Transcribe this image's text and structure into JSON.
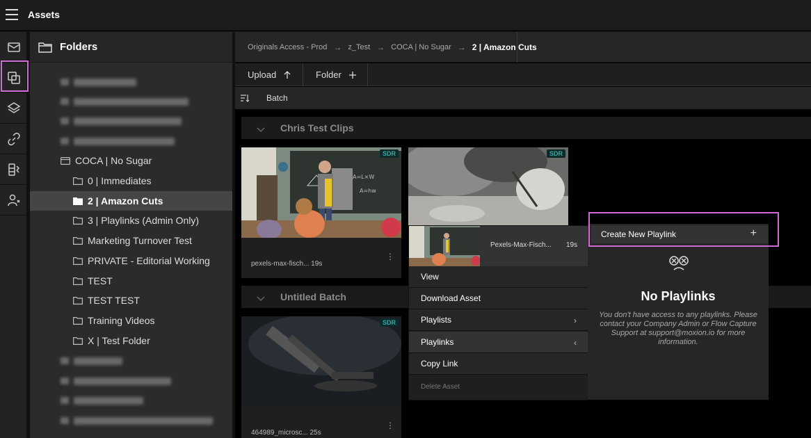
{
  "app": {
    "title": "Assets"
  },
  "folders": {
    "header": "Folders",
    "items": [
      {
        "label": "COCA | No Sugar",
        "level": 0,
        "type": "collection"
      },
      {
        "label": "0 | Immediates",
        "level": 1,
        "type": "folder"
      },
      {
        "label": "2 | Amazon Cuts",
        "level": 1,
        "type": "folder",
        "selected": true
      },
      {
        "label": "3 | Playlinks (Admin Only)",
        "level": 1,
        "type": "folder"
      },
      {
        "label": "Marketing Turnover Test",
        "level": 1,
        "type": "folder"
      },
      {
        "label": "PRIVATE - Editorial Working",
        "level": 1,
        "type": "folder"
      },
      {
        "label": "TEST",
        "level": 1,
        "type": "folder"
      },
      {
        "label": "TEST TEST",
        "level": 1,
        "type": "folder"
      },
      {
        "label": "Training Videos",
        "level": 1,
        "type": "folder"
      },
      {
        "label": "X | Test Folder",
        "level": 1,
        "type": "folder"
      }
    ]
  },
  "breadcrumb": {
    "items": [
      "Originals Access - Prod",
      "z_Test",
      "COCA | No Sugar"
    ],
    "current": "2 | Amazon Cuts"
  },
  "toolbar": {
    "upload_label": "Upload",
    "folder_label": "Folder",
    "batch_label": "Batch"
  },
  "groups": [
    {
      "title": "Chris Test Clips"
    },
    {
      "title": "Untitled Batch"
    }
  ],
  "cards": [
    {
      "badge": "SDR",
      "name": "pexels-max-fisch...",
      "duration": "19s"
    },
    {
      "badge": "SDR"
    },
    {
      "badge": "SDR",
      "name": "464989_microsc...",
      "duration": "25s"
    }
  ],
  "context_menu": {
    "asset_name": "Pexels-Max-Fisch...",
    "asset_duration": "19s",
    "items": {
      "view": "View",
      "download": "Download Asset",
      "playlists": "Playlists",
      "playlinks": "Playlinks",
      "copy_link": "Copy Link",
      "delete": "Delete Asset"
    }
  },
  "playlinks_panel": {
    "create_label": "Create New Playlink",
    "empty_title": "No Playlinks",
    "empty_message": "You don't have access to any playlinks. Please contact your Company Admin or Flow Capture Support at support@moxion.io for more information."
  },
  "colors": {
    "highlight": "#d06ad8",
    "sdr_badge": "#3aa"
  }
}
